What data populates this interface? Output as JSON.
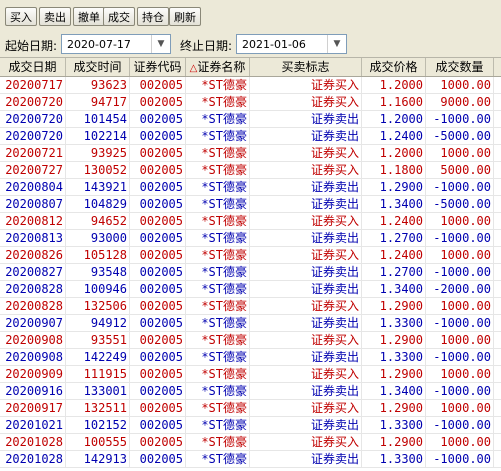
{
  "toolbar": {
    "buttons": [
      "买入",
      "卖出",
      "撤单",
      "成交",
      "持仓",
      "刷新"
    ]
  },
  "filter": {
    "start_label": "起始日期:",
    "start_value": "2020-07-17",
    "end_label": "终止日期:",
    "end_value": "2021-01-06"
  },
  "table": {
    "headers": [
      "成交日期",
      "成交时间",
      "证券代码",
      "证券名称",
      "买卖标志",
      "成交价格",
      "成交数量"
    ],
    "sort_marker": "△",
    "rows": [
      {
        "date": "20200717",
        "time": "93623",
        "code": "002005",
        "name": "*ST德豪",
        "side": "证券买入",
        "price": "1.2000",
        "qty": "1000.00",
        "type": "buy"
      },
      {
        "date": "20200720",
        "time": "94717",
        "code": "002005",
        "name": "*ST德豪",
        "side": "证券买入",
        "price": "1.1600",
        "qty": "9000.00",
        "type": "buy"
      },
      {
        "date": "20200720",
        "time": "101454",
        "code": "002005",
        "name": "*ST德豪",
        "side": "证券卖出",
        "price": "1.2000",
        "qty": "-1000.00",
        "type": "sell"
      },
      {
        "date": "20200720",
        "time": "102214",
        "code": "002005",
        "name": "*ST德豪",
        "side": "证券卖出",
        "price": "1.2400",
        "qty": "-5000.00",
        "type": "sell"
      },
      {
        "date": "20200721",
        "time": "93925",
        "code": "002005",
        "name": "*ST德豪",
        "side": "证券买入",
        "price": "1.2000",
        "qty": "1000.00",
        "type": "buy"
      },
      {
        "date": "20200727",
        "time": "130052",
        "code": "002005",
        "name": "*ST德豪",
        "side": "证券买入",
        "price": "1.1800",
        "qty": "5000.00",
        "type": "buy"
      },
      {
        "date": "20200804",
        "time": "143921",
        "code": "002005",
        "name": "*ST德豪",
        "side": "证券卖出",
        "price": "1.2900",
        "qty": "-1000.00",
        "type": "sell"
      },
      {
        "date": "20200807",
        "time": "104829",
        "code": "002005",
        "name": "*ST德豪",
        "side": "证券卖出",
        "price": "1.3400",
        "qty": "-5000.00",
        "type": "sell"
      },
      {
        "date": "20200812",
        "time": "94652",
        "code": "002005",
        "name": "*ST德豪",
        "side": "证券买入",
        "price": "1.2400",
        "qty": "1000.00",
        "type": "buy"
      },
      {
        "date": "20200813",
        "time": "93000",
        "code": "002005",
        "name": "*ST德豪",
        "side": "证券卖出",
        "price": "1.2700",
        "qty": "-1000.00",
        "type": "sell"
      },
      {
        "date": "20200826",
        "time": "105128",
        "code": "002005",
        "name": "*ST德豪",
        "side": "证券买入",
        "price": "1.2400",
        "qty": "1000.00",
        "type": "buy"
      },
      {
        "date": "20200827",
        "time": "93548",
        "code": "002005",
        "name": "*ST德豪",
        "side": "证券卖出",
        "price": "1.2700",
        "qty": "-1000.00",
        "type": "sell"
      },
      {
        "date": "20200828",
        "time": "100946",
        "code": "002005",
        "name": "*ST德豪",
        "side": "证券卖出",
        "price": "1.3400",
        "qty": "-2000.00",
        "type": "sell"
      },
      {
        "date": "20200828",
        "time": "132506",
        "code": "002005",
        "name": "*ST德豪",
        "side": "证券买入",
        "price": "1.2900",
        "qty": "1000.00",
        "type": "buy"
      },
      {
        "date": "20200907",
        "time": "94912",
        "code": "002005",
        "name": "*ST德豪",
        "side": "证券卖出",
        "price": "1.3300",
        "qty": "-1000.00",
        "type": "sell"
      },
      {
        "date": "20200908",
        "time": "93551",
        "code": "002005",
        "name": "*ST德豪",
        "side": "证券买入",
        "price": "1.2900",
        "qty": "1000.00",
        "type": "buy"
      },
      {
        "date": "20200908",
        "time": "142249",
        "code": "002005",
        "name": "*ST德豪",
        "side": "证券卖出",
        "price": "1.3300",
        "qty": "-1000.00",
        "type": "sell"
      },
      {
        "date": "20200909",
        "time": "111915",
        "code": "002005",
        "name": "*ST德豪",
        "side": "证券买入",
        "price": "1.2900",
        "qty": "1000.00",
        "type": "buy"
      },
      {
        "date": "20200916",
        "time": "133001",
        "code": "002005",
        "name": "*ST德豪",
        "side": "证券卖出",
        "price": "1.3400",
        "qty": "-1000.00",
        "type": "sell"
      },
      {
        "date": "20200917",
        "time": "132511",
        "code": "002005",
        "name": "*ST德豪",
        "side": "证券买入",
        "price": "1.2900",
        "qty": "1000.00",
        "type": "buy"
      },
      {
        "date": "20201021",
        "time": "102152",
        "code": "002005",
        "name": "*ST德豪",
        "side": "证券卖出",
        "price": "1.3300",
        "qty": "-1000.00",
        "type": "sell"
      },
      {
        "date": "20201028",
        "time": "100555",
        "code": "002005",
        "name": "*ST德豪",
        "side": "证券买入",
        "price": "1.2900",
        "qty": "1000.00",
        "type": "buy"
      },
      {
        "date": "20201028",
        "time": "142913",
        "code": "002005",
        "name": "*ST德豪",
        "side": "证券卖出",
        "price": "1.3300",
        "qty": "-1000.00",
        "type": "sell"
      }
    ]
  }
}
